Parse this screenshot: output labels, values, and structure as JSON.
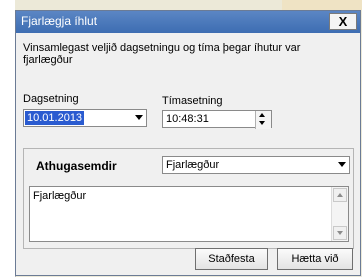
{
  "window": {
    "title": "Fjarlægja íhlut",
    "close_glyph": "X"
  },
  "message": "Vinsamlegast veljið dagsetningu og tíma þegar íhutur var fjarlægður",
  "date": {
    "label": "Dagsetning",
    "value": "10.01.2013"
  },
  "time": {
    "label": "Tímasetning",
    "value": "10:48:31"
  },
  "notes": {
    "label": "Athugasemdir",
    "selected": "Fjarlægður",
    "text": "Fjarlægður"
  },
  "buttons": {
    "confirm": "Staðfesta",
    "cancel": "Hætta við"
  },
  "colors": {
    "titlebar": "#4a79bd",
    "selection": "#2a5bd0"
  }
}
